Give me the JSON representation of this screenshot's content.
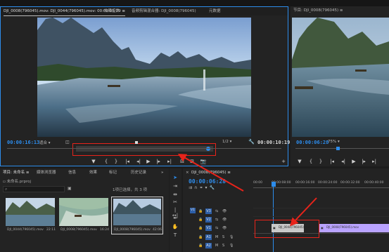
{
  "source_monitor": {
    "tabs": [
      "DJI_0008(796045).mov: DJI_0044(796045).mov: 00:00:05:29 ≡",
      "效果控件",
      "音频剪辑混合器: DJI_0008(796045)",
      "元数据"
    ],
    "timecode_left": "00:00:16:13",
    "timecode_right": "00:00:10:19",
    "fit_label": "适合",
    "fraction": "1/2"
  },
  "program_monitor": {
    "tab": "节目: DJI_0008(796045) ≡",
    "timecode": "00:00:06:28",
    "zoom": "75%"
  },
  "project_panel": {
    "tabs": [
      "项目: 未命名 ≡",
      "媒体浏览器",
      "信息",
      "效果",
      "标记",
      "历史记录"
    ],
    "project_file": "未命名.prproj",
    "selection_info": "1项已选择，共 3 项",
    "clips": [
      {
        "name": "DJI_0044(796045).mov",
        "duration": "22:11"
      },
      {
        "name": "DJI_0008(796045).mov",
        "duration": "16:24"
      },
      {
        "name": "DJI_0008(796045).mov",
        "duration": "42:06"
      }
    ]
  },
  "timeline": {
    "tab": "DJI_0008(796045) ≡",
    "timecode": "00:00:06:28",
    "ruler": [
      "00:00",
      "00:00:08:00",
      "00:00:16:00",
      "00:00:24:00",
      "00:00:32:00",
      "00:00:40:00"
    ],
    "video_tracks": [
      "V3",
      "V2",
      "V1"
    ],
    "audio_tracks": [
      "A1",
      "A2",
      "A3"
    ],
    "clip_v1_a": "DJI_0044(796045).mov",
    "clip_v1_b": "DJI_0008(796045).mov"
  },
  "colors": {
    "accent": "#2d8ceb",
    "highlight": "#e8231a",
    "clip_purple": "#b9a3ff"
  }
}
